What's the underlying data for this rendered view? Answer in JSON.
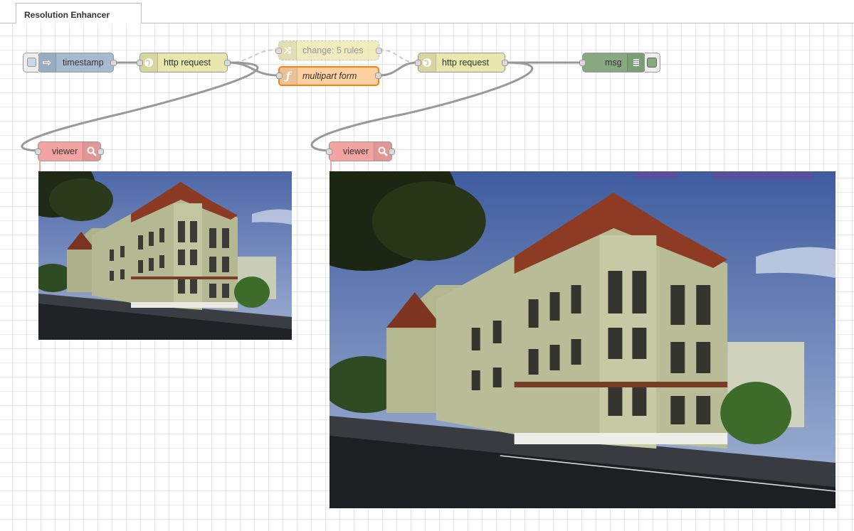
{
  "tab": {
    "title": "Resolution Enhancer"
  },
  "nodes": {
    "timestamp": {
      "label": "timestamp",
      "icon": "inject-arrow-icon",
      "color": "#a6bbcf"
    },
    "http_request_1": {
      "label": "http request",
      "icon": "globe-icon",
      "color": "#e7e7ae"
    },
    "change": {
      "label": "change: 5 rules",
      "icon": "shuffle-icon",
      "color": "#e2d96e",
      "state": "disabled"
    },
    "function": {
      "label": "multipart form",
      "icon": "function-icon",
      "color": "#fdd0a2"
    },
    "http_request_2": {
      "label": "http request",
      "icon": "globe-icon",
      "color": "#e7e7ae"
    },
    "debug": {
      "label": "msg",
      "icon": "debug-list-icon",
      "color": "#87a980"
    },
    "viewer_1": {
      "label": "viewer",
      "icon": "magnifier-icon",
      "color": "#f4a3a3"
    },
    "viewer_2": {
      "label": "viewer",
      "icon": "magnifier-icon",
      "color": "#f4a3a3"
    }
  },
  "images": {
    "viewer_1": {
      "subject": "building-photo-low-resolution"
    },
    "viewer_2": {
      "subject": "building-photo-enhanced"
    }
  }
}
